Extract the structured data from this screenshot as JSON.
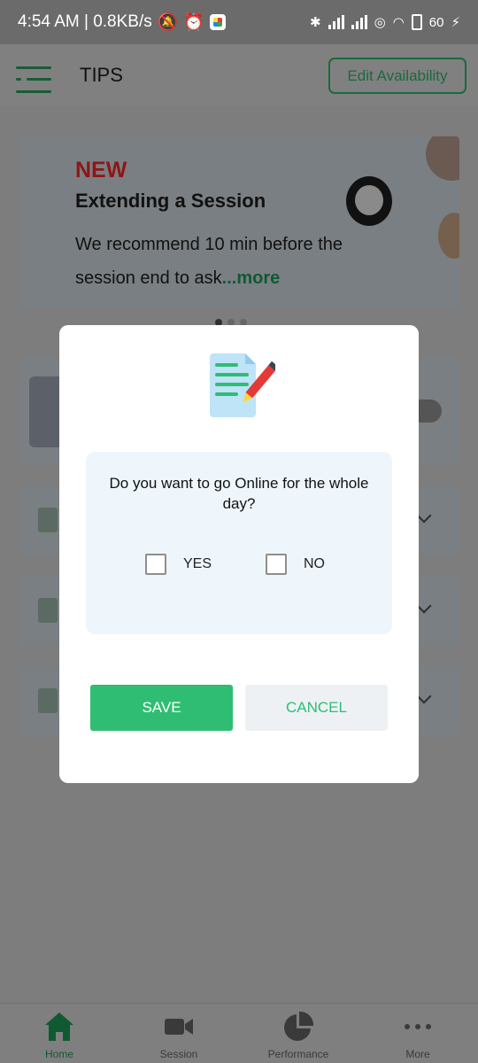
{
  "status_bar": {
    "time_speed": "4:54 AM | 0.8KB/s",
    "battery": "60",
    "icons": [
      "mute-icon",
      "alarm-icon",
      "app-icon",
      "bluetooth-icon",
      "signal-icon",
      "signal-icon",
      "hotspot-icon",
      "wifi-icon",
      "battery-icon",
      "charging-icon"
    ]
  },
  "app_bar": {
    "title": "TIPS",
    "edit_availability_label": "Edit Availability",
    "menu_icon": "menu-icon"
  },
  "banner": {
    "tag": "NEW",
    "title": "Extending a Session",
    "text": "We recommend 10 min before the session end to ask",
    "more": "...more",
    "active_slide": 1,
    "total_slides": 3
  },
  "dialog": {
    "icon": "document-edit-icon",
    "question": "Do you want to go Online for the whole day?",
    "yes_label": "YES",
    "no_label": "NO",
    "yes_checked": false,
    "no_checked": false,
    "save_label": "SAVE",
    "cancel_label": "CANCEL"
  },
  "bottom_nav": {
    "items": [
      {
        "label": "Home",
        "icon": "home-icon",
        "active": true
      },
      {
        "label": "Session",
        "icon": "video-camera-icon",
        "active": false
      },
      {
        "label": "Performance",
        "icon": "pie-chart-icon",
        "active": false
      },
      {
        "label": "More",
        "icon": "more-dots-icon",
        "active": false
      }
    ]
  },
  "colors": {
    "primary_green": "#2fbd73",
    "dark_green": "#1a6a3e",
    "new_red": "#c62828",
    "dialog_box": "#eef6fc",
    "overlay": "#7d7d7d"
  }
}
